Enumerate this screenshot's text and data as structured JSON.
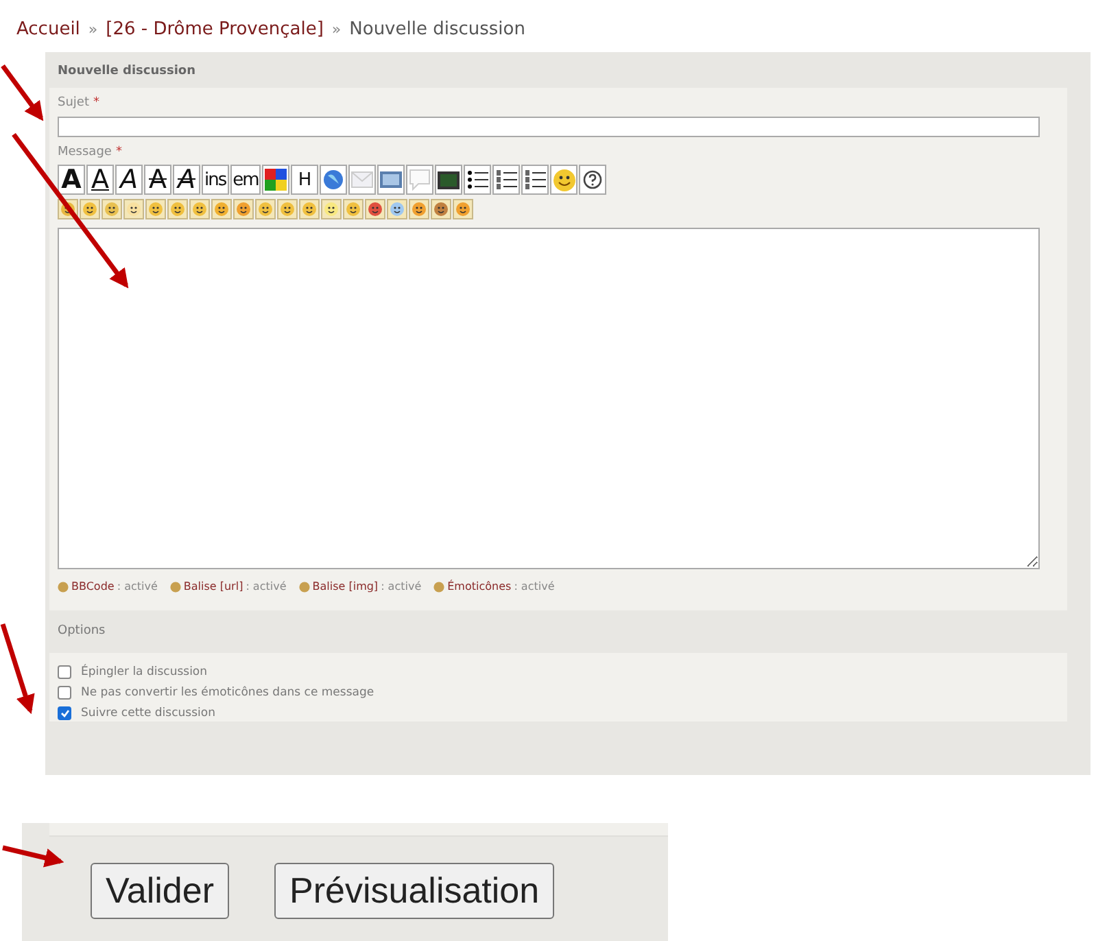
{
  "breadcrumb": [
    {
      "label": "Accueil",
      "kind": "link"
    },
    {
      "label": "[26 - Drôme Provençale]",
      "kind": "link"
    },
    {
      "label": "Nouvelle discussion",
      "kind": "current"
    }
  ],
  "breadcrumb_separator": "»",
  "form": {
    "title": "Nouvelle discussion",
    "subject": {
      "label": "Sujet",
      "required_mark": "*"
    },
    "message": {
      "label": "Message",
      "required_mark": "*"
    },
    "toolbar": [
      {
        "kind": "bold",
        "label": "A"
      },
      {
        "kind": "underline",
        "label": "A"
      },
      {
        "kind": "italic",
        "label": "A"
      },
      {
        "kind": "strike",
        "label": "A"
      },
      {
        "kind": "strikeitalic",
        "label": "A"
      },
      {
        "kind": "plain",
        "label": "ins"
      },
      {
        "kind": "plain",
        "label": "em"
      },
      {
        "kind": "color"
      },
      {
        "kind": "plain",
        "label": "H"
      },
      {
        "kind": "globe"
      },
      {
        "kind": "envelope"
      },
      {
        "kind": "image"
      },
      {
        "kind": "bubble"
      },
      {
        "kind": "terminal"
      },
      {
        "kind": "bullets"
      },
      {
        "kind": "numbers"
      },
      {
        "kind": "letters"
      },
      {
        "kind": "smiley"
      },
      {
        "kind": "help"
      }
    ],
    "status": [
      {
        "label": "BBCode",
        "value": ": activé"
      },
      {
        "label": "Balise [url]",
        "value": ": activé"
      },
      {
        "label": "Balise [img]",
        "value": ": activé"
      },
      {
        "label": "Émoticônes",
        "value": ": activé"
      }
    ]
  },
  "options": {
    "title": "Options",
    "items": [
      {
        "label": "Épingler la discussion",
        "checked": false
      },
      {
        "label": "Ne pas convertir les émoticônes dans ce message",
        "checked": false
      },
      {
        "label": "Suivre cette discussion",
        "checked": true
      }
    ]
  },
  "buttons": [
    "Valider",
    "Prévisualisation"
  ]
}
